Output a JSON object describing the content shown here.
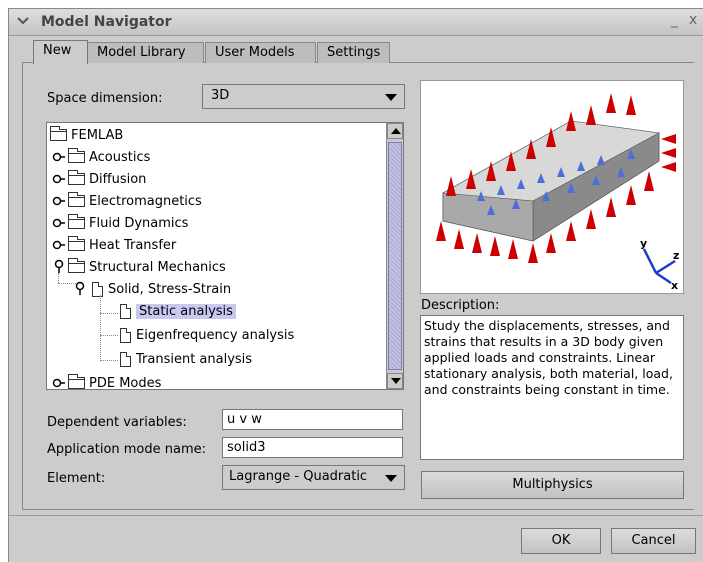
{
  "window": {
    "title": "Model Navigator",
    "minimize_glyph": "_",
    "close_glyph": "x"
  },
  "tabs": [
    {
      "label": "New",
      "active": true
    },
    {
      "label": "Model Library",
      "active": false
    },
    {
      "label": "User Models",
      "active": false
    },
    {
      "label": "Settings",
      "active": false
    }
  ],
  "space_dimension": {
    "label": "Space dimension:",
    "value": "3D"
  },
  "tree": {
    "items": [
      {
        "label": "FEMLAB",
        "icon": "folder-icon"
      },
      {
        "label": "Acoustics",
        "icon": "folder-icon"
      },
      {
        "label": "Diffusion",
        "icon": "folder-icon"
      },
      {
        "label": "Electromagnetics",
        "icon": "folder-icon"
      },
      {
        "label": "Fluid Dynamics",
        "icon": "folder-icon"
      },
      {
        "label": "Heat Transfer",
        "icon": "folder-icon"
      },
      {
        "label": "Structural Mechanics",
        "icon": "folder-icon"
      },
      {
        "label": "Solid, Stress-Strain",
        "icon": "document-icon"
      },
      {
        "label": "Static analysis",
        "icon": "document-icon",
        "selected": true
      },
      {
        "label": "Eigenfrequency analysis",
        "icon": "document-icon"
      },
      {
        "label": "Transient analysis",
        "icon": "document-icon"
      },
      {
        "label": "PDE Modes",
        "icon": "folder-icon"
      }
    ]
  },
  "fields": {
    "dependent_variables": {
      "label": "Dependent variables:",
      "value": "u v w"
    },
    "application_mode_name": {
      "label": "Application mode name:",
      "value": "solid3"
    },
    "element": {
      "label": "Element:",
      "value": "Lagrange - Quadratic"
    }
  },
  "preview": {
    "axis_labels": {
      "y": "y",
      "z": "z",
      "x": "x"
    }
  },
  "description": {
    "label": "Description:",
    "text": "Study the displacements, stresses, and strains that results in a 3D body given applied loads and constraints. Linear stationary analysis, both material, load, and constraints being constant in time."
  },
  "buttons": {
    "multiphysics": "Multiphysics",
    "ok": "OK",
    "cancel": "Cancel"
  },
  "colors": {
    "selection": "#c8c8f0",
    "arrow_red": "#cc0000",
    "scroll_thumb": "#b4b4e0"
  }
}
